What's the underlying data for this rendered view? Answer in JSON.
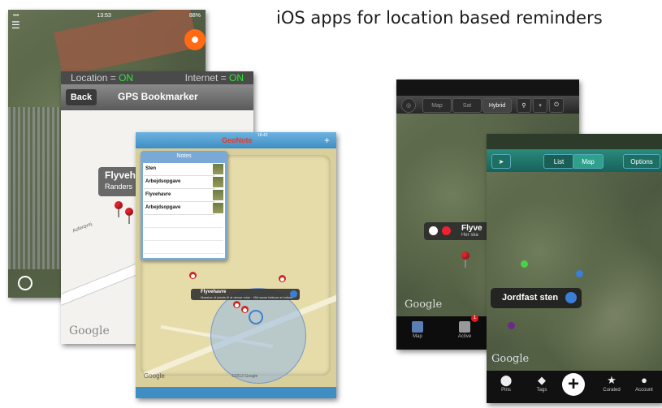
{
  "title": "iOS apps for location based reminders",
  "colors": {
    "accent_green": "#2ee82e",
    "pin_red": "#e0232a",
    "teal_bar": "#2b8a7b",
    "blue": "#3a7fd6"
  },
  "app1": {
    "status_time": "13:53",
    "status_battery": "88%",
    "icons": [
      "menu-icon",
      "record-icon",
      "location-icon"
    ]
  },
  "gps_bookmarker": {
    "location_label": "Location =",
    "location_value": "ON",
    "internet_label": "Internet =",
    "internet_value": "ON",
    "back_label": "Back",
    "nav_title": "GPS Bookmarker",
    "callout_title": "Flyveh",
    "callout_subtitle": "Randers",
    "road_name": "Asferqvej",
    "map_logo": "Google"
  },
  "geonote": {
    "status_time": "18:42",
    "brand": "GeoNote",
    "add_symbol": "+",
    "notes_header": "Notes",
    "notes": [
      {
        "label": "Sten"
      },
      {
        "label": "Arbejdsopgave"
      },
      {
        "label": "Flyvehavre"
      },
      {
        "label": "Arbejdsopgave"
      }
    ],
    "popup_title": "Flyvehavre",
    "popup_subtitle": "Massive of plants til at dense mine · Vild same fatisvar at indsde",
    "map_logo": "Google",
    "copyright": "©2013 Google"
  },
  "app4": {
    "segments": [
      "Map",
      "Sat",
      "Hybrid"
    ],
    "annotation_title": "Flyve",
    "annotation_subtitle": "Her ska",
    "map_logo": "Google",
    "tabs": [
      {
        "label": "Map"
      },
      {
        "label": "Active"
      }
    ],
    "badge": "1"
  },
  "app5": {
    "toggle": [
      "List",
      "Map"
    ],
    "options_label": "Options",
    "callout_title": "Jordfast sten",
    "map_logo": "Google",
    "add_symbol": "+",
    "tabs": [
      {
        "label": "Pins",
        "glyph": "⬤"
      },
      {
        "label": "Tags",
        "glyph": "◆"
      },
      {
        "label": "Curated",
        "glyph": "★"
      },
      {
        "label": "Account",
        "glyph": "●"
      }
    ]
  }
}
